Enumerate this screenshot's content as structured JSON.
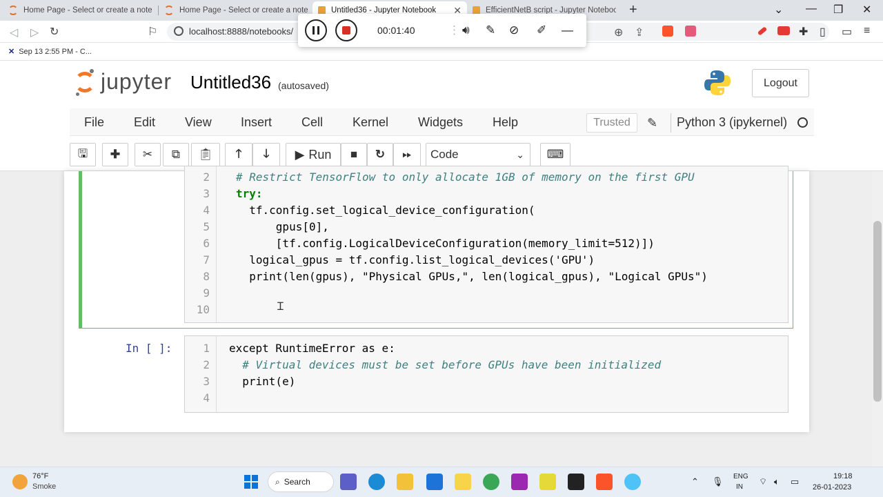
{
  "browser": {
    "tabs": [
      {
        "title": "Home Page - Select or create a noteb",
        "active": false
      },
      {
        "title": "Home Page - Select or create a noteb",
        "active": false
      },
      {
        "title": "Untitled36 - Jupyter Notebook",
        "active": true
      },
      {
        "title": "EfficientNetB script - Jupyter Noteboo",
        "active": false
      }
    ],
    "new_tab": "+",
    "url": "localhost:8888/notebooks/",
    "bookmark": "Sep 13 2:55 PM - C..."
  },
  "recorder": {
    "timer": "00:01:40"
  },
  "jupyter": {
    "logo_text": "jupyter",
    "notebook_title": "Untitled36",
    "autosave": "(autosaved)",
    "logout_label": "Logout",
    "menus": [
      "File",
      "Edit",
      "View",
      "Insert",
      "Cell",
      "Kernel",
      "Widgets",
      "Help"
    ],
    "trusted": "Trusted",
    "kernel_name": "Python 3 (ipykernel)",
    "toolbar": {
      "run_label": "Run",
      "cell_type": "Code"
    }
  },
  "cells": [
    {
      "prompt": "",
      "lines": [
        {
          "n": "2",
          "text": "# Restrict TensorFlow to only allocate 1GB of memory on the first GPU"
        },
        {
          "n": "3",
          "text": "try:"
        },
        {
          "n": "4",
          "text": "  tf.config.set_logical_device_configuration("
        },
        {
          "n": "5",
          "text": "      gpus[0],"
        },
        {
          "n": "6",
          "text": "      [tf.config.LogicalDeviceConfiguration(memory_limit=512)])"
        },
        {
          "n": "7",
          "text": "  logical_gpus = tf.config.list_logical_devices('GPU')"
        },
        {
          "n": "8",
          "text": "  print(len(gpus), \"Physical GPUs,\", len(logical_gpus), \"Logical GPUs\")"
        },
        {
          "n": "9",
          "text": ""
        },
        {
          "n": "10",
          "text": ""
        }
      ]
    },
    {
      "prompt": "In [ ]:",
      "lines": [
        {
          "n": "1",
          "text": "except RuntimeError as e:"
        },
        {
          "n": "2",
          "text": "  # Virtual devices must be set before GPUs have been initialized"
        },
        {
          "n": "3",
          "text": "  print(e)"
        },
        {
          "n": "4",
          "text": ""
        }
      ]
    }
  ],
  "taskbar": {
    "temp": "76°F",
    "weather": "Smoke",
    "search_label": "Search",
    "lang_line1": "ENG",
    "lang_line2": "IN",
    "time": "19:18",
    "date": "26-01-2023"
  },
  "colors": {
    "jupyter_orange": "#f37726",
    "cell_selected_border": "#66bb6a",
    "prompt_blue": "#303f9f",
    "comment": "#408080",
    "keyword": "#008000",
    "string": "#ba2121"
  }
}
